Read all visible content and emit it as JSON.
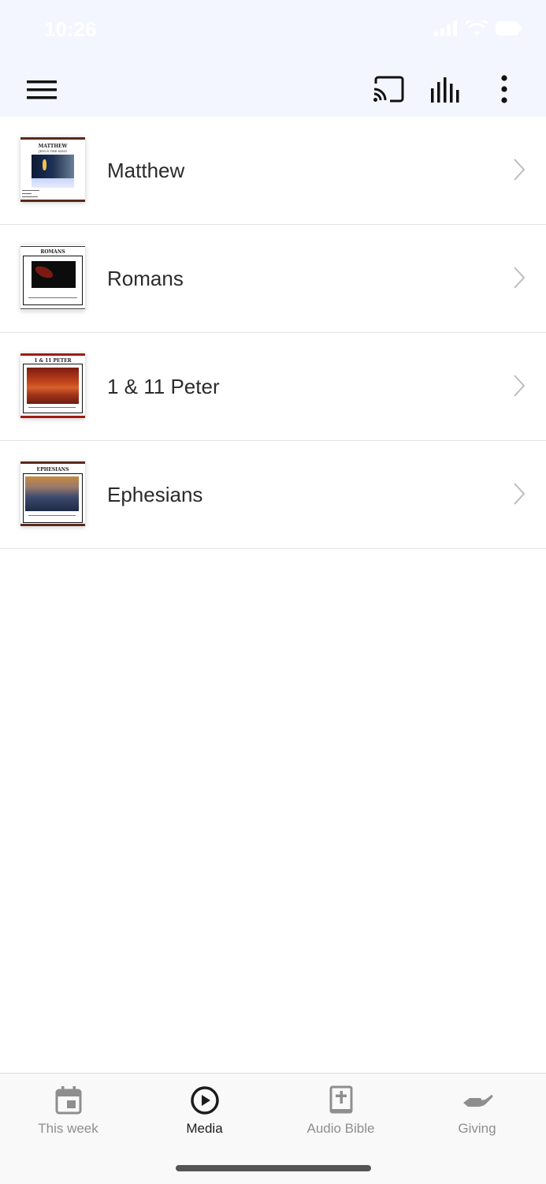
{
  "status_bar": {
    "time": "10:26"
  },
  "header": {
    "menu_icon": "hamburger-icon",
    "cast_icon": "cast-icon",
    "audio_icon": "equalizer-icon",
    "more_icon": "more-vertical-icon"
  },
  "media_list": [
    {
      "label": "Matthew",
      "cover_title": "MATTHEW",
      "cover_subtitle": "JESUS THE KING"
    },
    {
      "label": "Romans",
      "cover_title": "ROMANS",
      "cover_subtitle": ""
    },
    {
      "label": "1 & 11 Peter",
      "cover_title": "1 & 11 PETER",
      "cover_subtitle": ""
    },
    {
      "label": "Ephesians",
      "cover_title": "EPHESIANS",
      "cover_subtitle": ""
    }
  ],
  "tabs": [
    {
      "label": "This week",
      "icon": "calendar-icon",
      "active": false
    },
    {
      "label": "Media",
      "icon": "play-circle-icon",
      "active": true
    },
    {
      "label": "Audio Bible",
      "icon": "bible-icon",
      "active": false
    },
    {
      "label": "Giving",
      "icon": "giving-hand-icon",
      "active": false
    }
  ],
  "colors": {
    "header_bg": "#f4f6ff",
    "active_tab": "#1c1c1c",
    "inactive_tab": "#8e8e8e"
  }
}
